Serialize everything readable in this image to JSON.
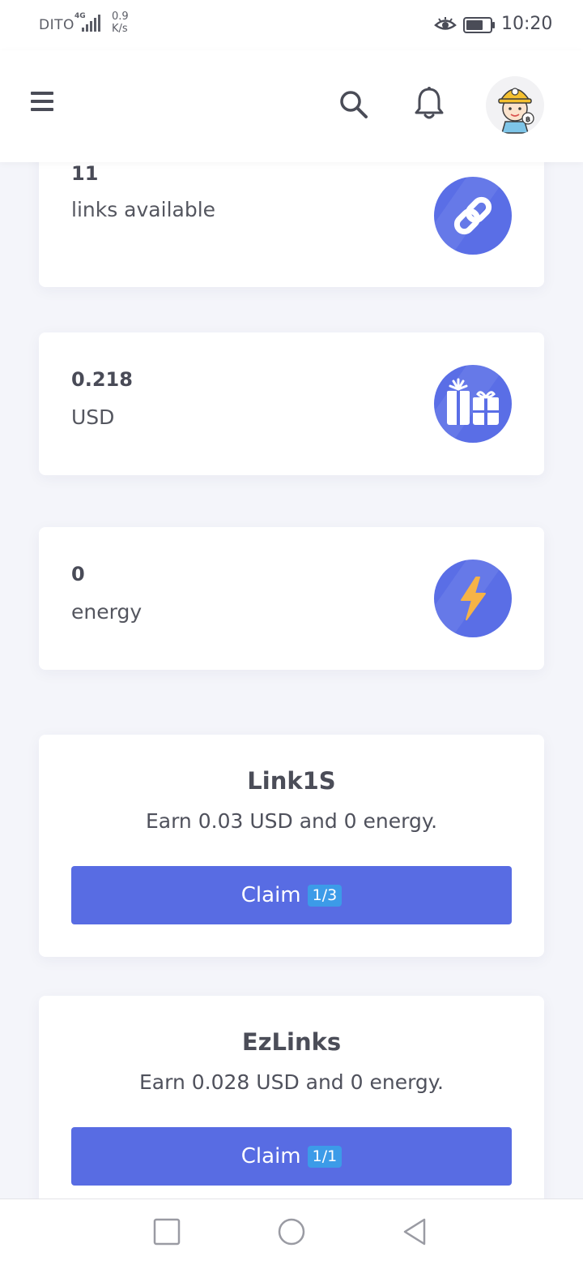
{
  "status_bar": {
    "carrier": "DITO",
    "network": "4G",
    "speed_value": "0.9",
    "speed_unit": "K/s",
    "time": "10:20"
  },
  "header": {
    "icons": [
      "menu-icon",
      "search-icon",
      "bell-icon",
      "avatar"
    ]
  },
  "stats": [
    {
      "value": "11",
      "label": "links available",
      "icon": "link-icon"
    },
    {
      "value": "0.218",
      "label": "USD",
      "icon": "gift-icon"
    },
    {
      "value": "0",
      "label": "energy",
      "icon": "lightning-icon"
    }
  ],
  "offers": [
    {
      "title": "Link1S",
      "description": "Earn 0.03 USD and 0 energy.",
      "button_label": "Claim",
      "badge": "1/3"
    },
    {
      "title": "EzLinks",
      "description": "Earn 0.028 USD and 0 energy.",
      "button_label": "Claim",
      "badge": "1/1"
    }
  ],
  "colors": {
    "accent": "#586ce3",
    "badge": "#3c9be8",
    "icon_circle": "#5a6ee6",
    "lightning": "#f6b346",
    "background": "#f4f5fa"
  }
}
